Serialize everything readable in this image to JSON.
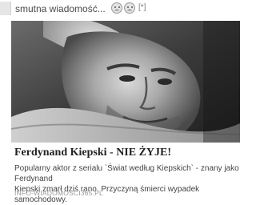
{
  "post": {
    "status_text": "smutna wiadomość...",
    "flag_text": "[*]",
    "emoticons": [
      "sad-face-icon",
      "sad-face-icon"
    ]
  },
  "link_card": {
    "title": "Ferdynand Kiepski - NIE ŻYJE!",
    "description_line_1": "Popularny aktor z serialu `Świat według Kiepskich` - znany jako Ferdynand",
    "description_line_2": "Kiepski zmarł dziś rano. Przyczyną śmierci wypadek samochodowy.",
    "source": "INFO-WIADOMOSCI365.PL"
  }
}
